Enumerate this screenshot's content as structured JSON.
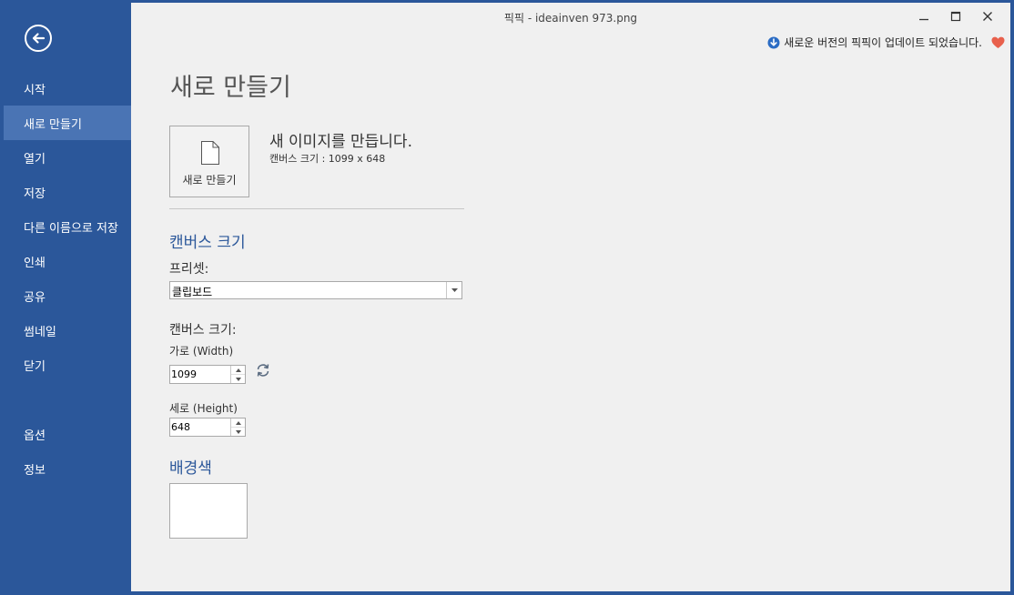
{
  "window": {
    "title": "픽픽 - ideainven 973.png"
  },
  "sidebar": {
    "items": [
      {
        "label": "시작"
      },
      {
        "label": "새로 만들기"
      },
      {
        "label": "열기"
      },
      {
        "label": "저장"
      },
      {
        "label": "다른 이름으로 저장"
      },
      {
        "label": "인쇄"
      },
      {
        "label": "공유"
      },
      {
        "label": "썸네일"
      },
      {
        "label": "닫기"
      },
      {
        "label": "옵션"
      },
      {
        "label": "정보"
      }
    ],
    "active_item": "새로 만들기",
    "background_color": "#2b579a",
    "active_color": "#4a74b4"
  },
  "update_notice": {
    "text": "새로운 버전의 픽픽이 업데이트 되었습니다.",
    "icon": "download-icon",
    "heart_icon": "heart-icon",
    "heart_color": "#e8604c"
  },
  "page": {
    "title": "새로 만들기",
    "new_tile_label": "새로 만들기",
    "new_heading": "새 이미지를 만듭니다.",
    "canvas_info": "캔버스 크기 : 1099 x 648"
  },
  "canvas_size_section": {
    "title": "캔버스 크기",
    "preset_label": "프리셋:",
    "preset_value": "클립보드",
    "size_label": "캔버스 크기:",
    "width_label": "가로 (Width)",
    "width_value": "1099",
    "height_label": "세로 (Height)",
    "height_value": "648"
  },
  "background_section": {
    "title": "배경색",
    "color": "#ffffff"
  },
  "accent_color": "#2b579a"
}
